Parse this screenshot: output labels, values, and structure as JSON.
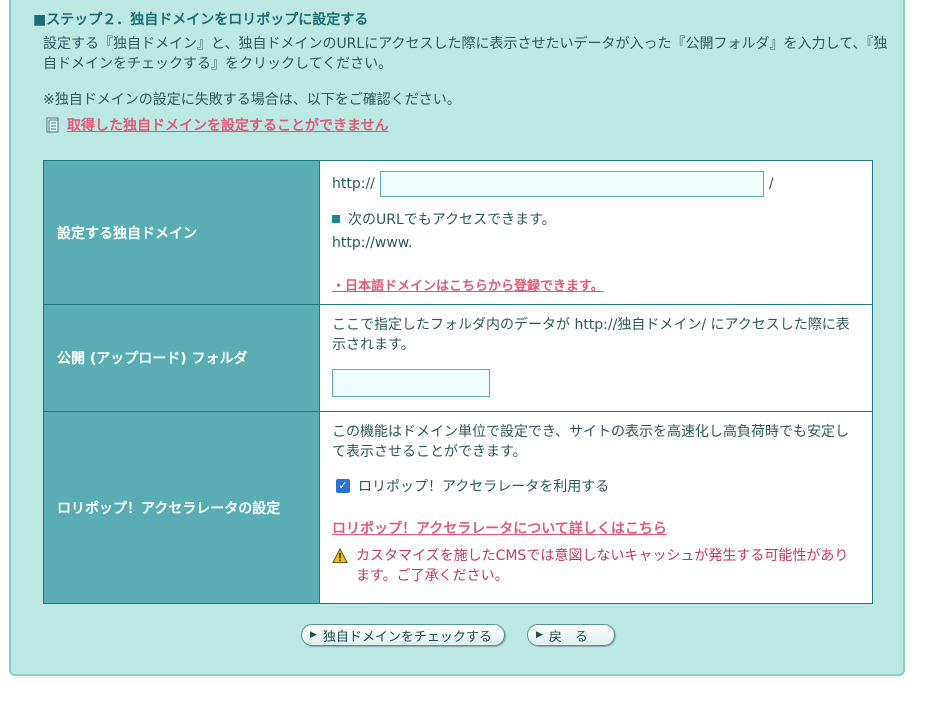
{
  "step": {
    "title": "■ステップ２．独自ドメインをロリポップに設定する",
    "description": "設定する『独自ドメイン』と、独自ドメインのURLにアクセスした際に表示させたいデータが入った『公開フォルダ』を入力して、『独自ドメインをチェックする』をクリックしてください。",
    "note": "※独自ドメインの設定に失敗する場合は、以下をご確認ください。",
    "help_link": "取得した独自ドメインを設定することができません"
  },
  "rows": {
    "domain": {
      "label": "設定する独自ドメイン",
      "prefix": "http://",
      "value": "",
      "suffix": "/",
      "also_note": "次のURLでもアクセスできます。",
      "www_url": "http://www.",
      "jp_link": "・日本語ドメインはこちらから登録できます。"
    },
    "folder": {
      "label": "公開 (アップロード) フォルダ",
      "help": "ここで指定したフォルダ内のデータが http://独自ドメイン/ にアクセスした際に表示されます。",
      "value": ""
    },
    "accelerator": {
      "label": "ロリポップ！アクセラレータの設定",
      "help": "この機能はドメイン単位で設定でき、サイトの表示を高速化し高負荷時でも安定して表示させることができます。",
      "checkbox_label": "ロリポップ！アクセラレータを利用する",
      "checked": true,
      "link": "ロリポップ！アクセラレータについて詳しくはこちら",
      "warning": "カスタマイズを施したCMSでは意図しないキャッシュが発生する可能性があります。ご了承ください。"
    }
  },
  "buttons": {
    "check": "独自ドメインをチェックする",
    "back": "戻　る"
  },
  "colors": {
    "panel_bg": "#bce8e4",
    "label_bg": "#5aaeb3",
    "link": "#e05a7a",
    "warning": "#c0396a"
  },
  "icons": {
    "help": "document-icon",
    "warning": "warning-triangle-icon",
    "button": "play-arrow-icon"
  }
}
